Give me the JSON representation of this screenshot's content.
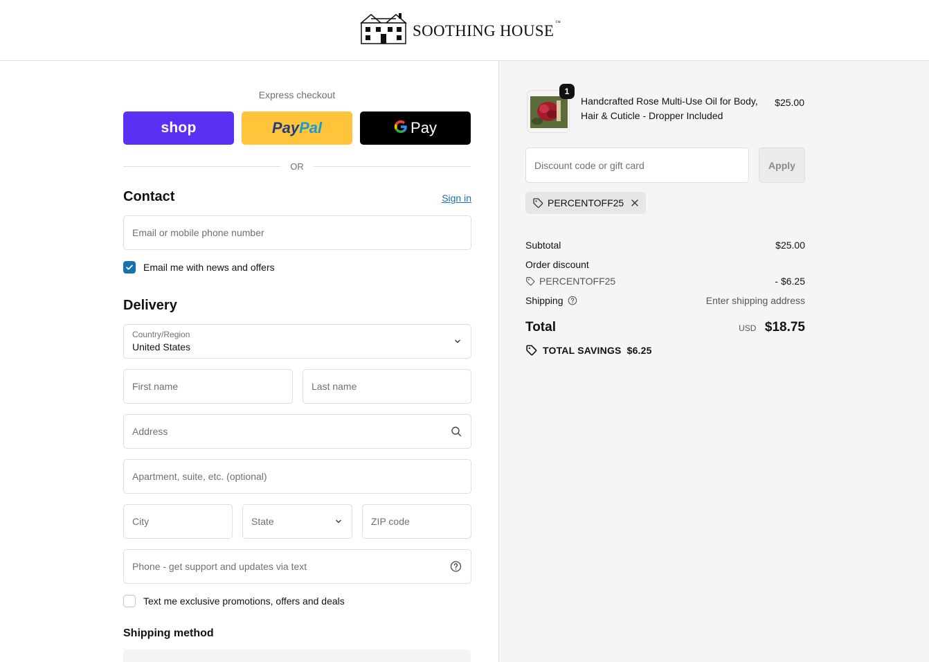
{
  "brand": {
    "name": "SOOTHING HOUSE",
    "tm": "™"
  },
  "express": {
    "label": "Express checkout",
    "shop_label": "shop",
    "paypal_label_1": "Pay",
    "paypal_label_2": "Pal",
    "gpay_g": "G",
    "gpay_label": "Pay",
    "or_label": "OR"
  },
  "contact": {
    "title": "Contact",
    "signin_label": "Sign in",
    "email_placeholder": "Email or mobile phone number",
    "news_checkbox_label": "Email me with news and offers",
    "news_checked": true
  },
  "delivery": {
    "title": "Delivery",
    "country_label": "Country/Region",
    "country_value": "United States",
    "first_name_placeholder": "First name",
    "last_name_placeholder": "Last name",
    "address_placeholder": "Address",
    "apartment_placeholder": "Apartment, suite, etc. (optional)",
    "city_placeholder": "City",
    "state_placeholder": "State",
    "zip_placeholder": "ZIP code",
    "phone_placeholder": "Phone - get support and updates via text",
    "sms_checkbox_label": "Text me exclusive promotions, offers and deals",
    "sms_checked": false
  },
  "shipping_method": {
    "title": "Shipping method"
  },
  "order": {
    "product": {
      "name": "Handcrafted Rose Multi-Use Oil for Body, Hair & Cuticle - Dropper Included",
      "price": "$25.00",
      "quantity": "1"
    },
    "discount_placeholder": "Discount code or gift card",
    "apply_label": "Apply",
    "applied_code": "PERCENTOFF25",
    "subtotal_label": "Subtotal",
    "subtotal_value": "$25.00",
    "order_discount_label": "Order discount",
    "discount_code": "PERCENTOFF25",
    "discount_value": "- $6.25",
    "shipping_label": "Shipping",
    "shipping_value": "Enter shipping address",
    "total_label": "Total",
    "currency": "USD",
    "total_value": "$18.75",
    "savings_label": "TOTAL SAVINGS",
    "savings_value": "$6.25"
  },
  "colors": {
    "shop_purple": "#5a31f4",
    "paypal_yellow": "#ffc439",
    "gpay_black": "#000000",
    "link_blue": "#1773b0",
    "summary_bg": "#f5f5f5"
  }
}
